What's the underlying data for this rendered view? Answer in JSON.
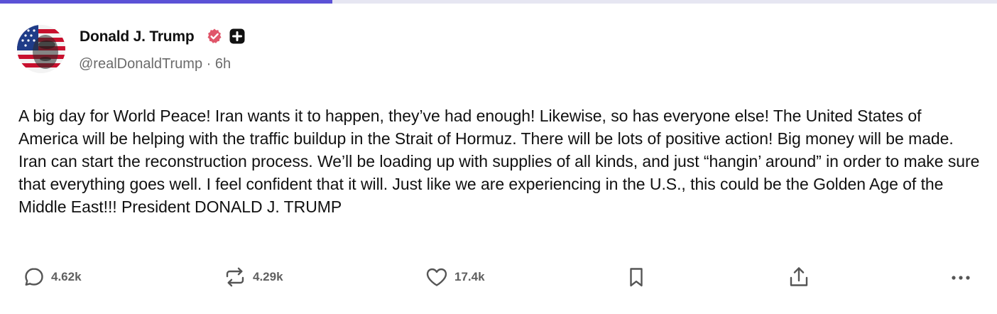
{
  "post": {
    "author": {
      "display_name": "Donald J. Trump",
      "handle": "@realDonaldTrump",
      "time_ago": "6h",
      "separator": " · "
    },
    "body": "A big day for World Peace! Iran wants it to happen, they’ve had enough! Likewise, so has everyone else! The United States of America will be helping with the traffic buildup in the Strait of Hormuz. There will be lots of positive action! Big money will be made. Iran can start the reconstruction process. We’ll be loading up with supplies of all kinds, and just “hangin’ around” in order to make sure that everything goes well. I feel confident that it will. Just like we are experiencing in the U.S., this could be the Golden Age of the Middle East!!! President DONALD J. TRUMP",
    "actions": {
      "replies": "4.62k",
      "reposts": "4.29k",
      "likes": "17.4k"
    }
  },
  "progress": {
    "fraction": 0.333,
    "color": "#5b52d6",
    "track_color": "#e6e6f2"
  },
  "icons": {
    "verified": "verified-badge-icon",
    "plus": "plus-badge-icon",
    "reply": "comment-icon",
    "repost": "repost-icon",
    "like": "heart-icon",
    "bookmark": "bookmark-icon",
    "share": "share-icon",
    "more": "more-icon"
  },
  "colors": {
    "verified_badge": "#e0566a",
    "text": "#111111",
    "muted": "#6b6b6b"
  }
}
